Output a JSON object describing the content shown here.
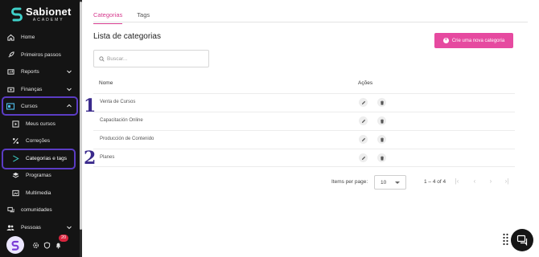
{
  "brand": {
    "name": "Sabionet",
    "sub": "ACADEMY"
  },
  "sidebar": {
    "items": [
      {
        "label": "Home",
        "icon": "home-icon"
      },
      {
        "label": "Primeiros passos",
        "icon": "rocket-icon"
      },
      {
        "label": "Reports",
        "icon": "reports-icon"
      },
      {
        "label": "Finanças",
        "icon": "wallet-icon"
      },
      {
        "label": "Cursos",
        "icon": "courses-icon"
      },
      {
        "label": "Meus cursos",
        "icon": "play-square-icon"
      },
      {
        "label": "Correções",
        "icon": "percent-icon"
      },
      {
        "label": "Categorias e tags",
        "icon": "tag-icon"
      },
      {
        "label": "Programas",
        "icon": "layers-icon"
      },
      {
        "label": "Multimedia",
        "icon": "media-icon"
      },
      {
        "label": "comunidades",
        "icon": "chat-bubbles-icon"
      },
      {
        "label": "Pessoas",
        "icon": "people-icon"
      }
    ],
    "notifications_count": "20"
  },
  "annotations": {
    "first": "1",
    "second": "2"
  },
  "tabs": [
    {
      "label": "Categorias",
      "active": true
    },
    {
      "label": "Tags",
      "active": false
    }
  ],
  "main": {
    "title": "Lista de categorias",
    "create_button": "Crie uma nova categoria",
    "search_placeholder": "Buscar..."
  },
  "table": {
    "columns": [
      "Nome",
      "Ações"
    ],
    "rows": [
      {
        "name": "Venta de Cursos"
      },
      {
        "name": "Capacitación Online"
      },
      {
        "name": "Producción de Contenido"
      },
      {
        "name": "Planes"
      }
    ]
  },
  "pagination": {
    "items_per_page_label": "Items per page:",
    "items_per_page": "10",
    "range": "1 – 4 of 4"
  },
  "colors": {
    "accent": "#e64aa0",
    "sidebar_bg": "#141414",
    "highlight_outline": "#5b3cc4"
  }
}
